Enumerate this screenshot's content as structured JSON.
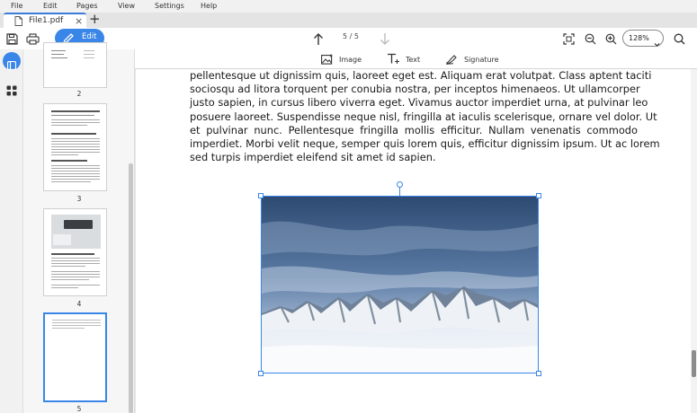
{
  "menu": [
    "File",
    "Edit",
    "Pages",
    "View",
    "Settings",
    "Help"
  ],
  "tab": {
    "title": "File1.pdf",
    "close": "×",
    "add": "+"
  },
  "toolbar": {
    "edit_label": "Edit",
    "page_indicator": "5 / 5",
    "zoom_value": "128%"
  },
  "edit_tools": {
    "image_label": "Image",
    "text_label": "Text",
    "signature_label": "Signature"
  },
  "thumbnails": [
    {
      "number": "2"
    },
    {
      "number": "3"
    },
    {
      "number": "4"
    },
    {
      "number": "5",
      "selected": true
    }
  ],
  "document": {
    "lines": [
      "pellentesque ut dignissim quis, laoreet eget est. Aliquam erat volutpat. Class aptent taciti",
      "sociosqu ad litora torquent per conubia nostra, per inceptos himenaeos. Ut ullamcorper",
      "justo sapien, in cursus libero viverra eget. Vivamus auctor imperdiet urna, at pulvinar leo",
      "posuere laoreet. Suspendisse neque nisl, fringilla at iaculis scelerisque, ornare vel dolor. Ut",
      "et pulvinar nunc. Pellentesque fringilla mollis efficitur. Nullam venenatis commodo",
      "imperdiet. Morbi velit neque, semper quis lorem quis, efficitur dignissim ipsum. Ut ac lorem",
      "sed turpis imperdiet eleifend sit amet id sapien."
    ],
    "image_subject": "snowy-mountain-range-photo"
  },
  "colors": {
    "accent": "#3a86e8",
    "tab_accent": "#3a7bd5"
  }
}
